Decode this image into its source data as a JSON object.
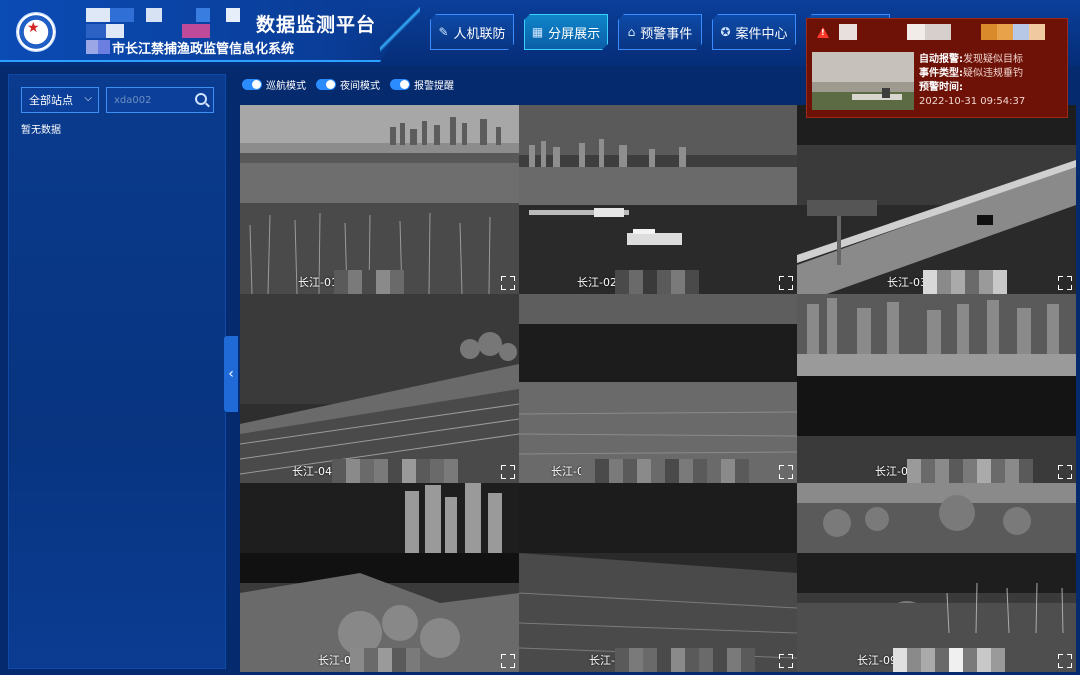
{
  "header": {
    "title": "数据监测平台",
    "subtitle": "市长江禁捕渔政监管信息化系统",
    "nav": [
      {
        "label": "人机联防",
        "icon": "pen-icon",
        "active": false
      },
      {
        "label": "分屏展示",
        "icon": "grid-icon",
        "active": true
      },
      {
        "label": "预警事件",
        "icon": "house-alert-icon",
        "active": false
      },
      {
        "label": "案件中心",
        "icon": "badge-icon",
        "active": false
      },
      {
        "label": "",
        "icon": "circle-icon",
        "active": false
      }
    ]
  },
  "sidebar": {
    "station_select": "全部站点",
    "search_placeholder": "xda002",
    "empty_text": "暂无数据"
  },
  "toggles": [
    {
      "label": "巡航模式",
      "on": true
    },
    {
      "label": "夜间模式",
      "on": true
    },
    {
      "label": "报警提醒",
      "on": true
    }
  ],
  "cameras": [
    {
      "label": "长江-01"
    },
    {
      "label": "长江-02"
    },
    {
      "label": "长江-03"
    },
    {
      "label": "长江-04"
    },
    {
      "label": "长江-0"
    },
    {
      "label": "长江-0"
    },
    {
      "label": "长江-0"
    },
    {
      "label": "长江-0"
    },
    {
      "label": "长江-09"
    }
  ],
  "alert": {
    "line1_label": "自动报警:",
    "line1_value": "发现疑似目标",
    "line2_label": "事件类型:",
    "line2_value": "疑似违规垂钓",
    "line3_label": "预警时间:",
    "time": "2022-10-31 09:54:37",
    "color": "#6e1208"
  }
}
